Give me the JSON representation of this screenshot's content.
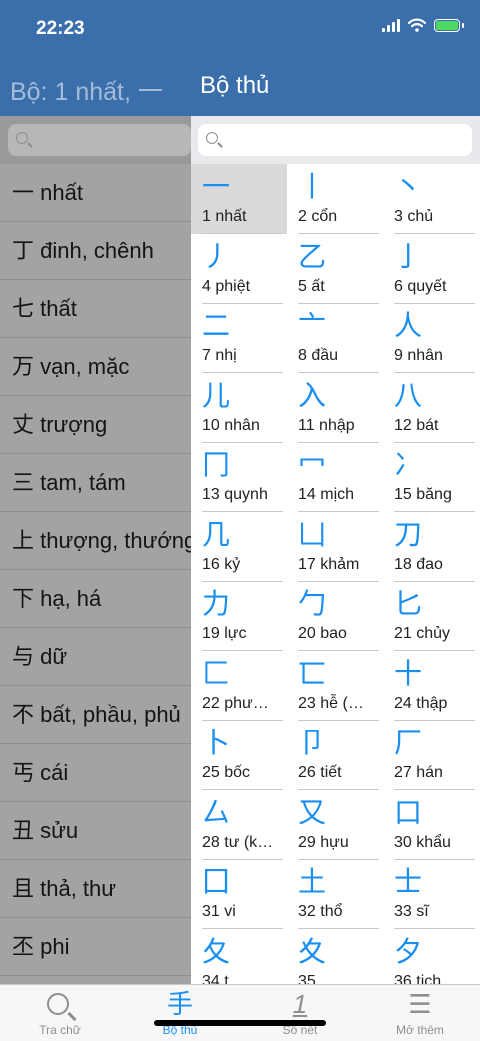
{
  "status": {
    "time": "22:23"
  },
  "header": {
    "left_title": "Bộ: 1 nhất, 一",
    "right_title": "Bộ thủ"
  },
  "colors": {
    "nav_bar": "#3a6fab",
    "accent": "#1a8ff0",
    "left_panel": "#a3a3a3"
  },
  "left_list": [
    "一 nhất",
    "丁 đinh, chênh",
    "七 thất",
    "万 vạn, mặc",
    "丈 trượng",
    "三 tam, tám",
    "上 thượng, thướng",
    "下 hạ, há",
    "与 dữ",
    "不 bất, phầu, phủ",
    "丐 cái",
    "丑 sửu",
    "且 thả, thư",
    "丕 phi"
  ],
  "radicals": [
    {
      "glyph": "一",
      "label": "1 nhất"
    },
    {
      "glyph": "丨",
      "label": "2 cổn"
    },
    {
      "glyph": "丶",
      "label": "3 chủ"
    },
    {
      "glyph": "丿",
      "label": "4 phiệt"
    },
    {
      "glyph": "乙",
      "label": "5 ất"
    },
    {
      "glyph": "亅",
      "label": "6 quyết"
    },
    {
      "glyph": "二",
      "label": "7 nhị"
    },
    {
      "glyph": "亠",
      "label": "8 đầu"
    },
    {
      "glyph": "人",
      "label": "9 nhân"
    },
    {
      "glyph": "儿",
      "label": "10 nhân"
    },
    {
      "glyph": "入",
      "label": "11 nhập"
    },
    {
      "glyph": "八",
      "label": "12 bát"
    },
    {
      "glyph": "冂",
      "label": "13 quynh"
    },
    {
      "glyph": "冖",
      "label": "14 mịch"
    },
    {
      "glyph": "冫",
      "label": "15 băng"
    },
    {
      "glyph": "几",
      "label": "16 kỷ"
    },
    {
      "glyph": "凵",
      "label": "17 khảm"
    },
    {
      "glyph": "刀",
      "label": "18 đao"
    },
    {
      "glyph": "力",
      "label": "19 lực"
    },
    {
      "glyph": "勹",
      "label": "20 bao"
    },
    {
      "glyph": "匕",
      "label": "21 chủy"
    },
    {
      "glyph": "匚",
      "label": "22 phư…"
    },
    {
      "glyph": "匸",
      "label": "23 hễ (…"
    },
    {
      "glyph": "十",
      "label": "24 thập"
    },
    {
      "glyph": "卜",
      "label": "25 bốc"
    },
    {
      "glyph": "卩",
      "label": "26 tiết"
    },
    {
      "glyph": "厂",
      "label": "27 hán"
    },
    {
      "glyph": "厶",
      "label": "28 tư (k…"
    },
    {
      "glyph": "又",
      "label": "29 hựu"
    },
    {
      "glyph": "口",
      "label": "30 khẩu"
    },
    {
      "glyph": "囗",
      "label": "31 vi"
    },
    {
      "glyph": "土",
      "label": "32 thổ"
    },
    {
      "glyph": "士",
      "label": "33 sĩ"
    },
    {
      "glyph": "夂",
      "label": "34 t…"
    },
    {
      "glyph": "夊",
      "label": "35 …"
    },
    {
      "glyph": "夕",
      "label": "36 tịch"
    }
  ],
  "tabs": [
    {
      "label": "Tra chữ",
      "icon": "search-icon"
    },
    {
      "label": "Bộ thủ",
      "icon": "radical-icon",
      "glyph": "手"
    },
    {
      "label": "Số nét",
      "icon": "stroke-count-icon",
      "glyph": "1"
    },
    {
      "label": "Mở thêm",
      "icon": "more-icon",
      "glyph": "☰"
    }
  ]
}
